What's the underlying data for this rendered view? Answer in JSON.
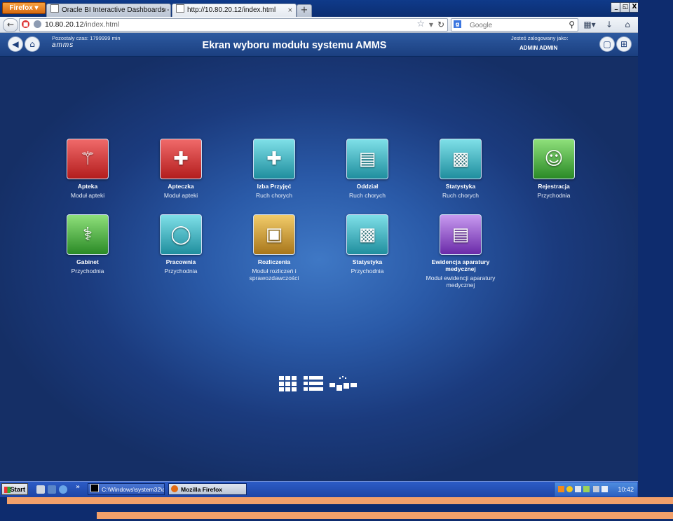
{
  "browser": {
    "menu_label": "Firefox ▾",
    "tabs": [
      {
        "label": "Oracle BI Interactive Dashboards - Ogóln...",
        "close": "×"
      },
      {
        "label": "http://10.80.20.12/index.html",
        "close": "×"
      }
    ],
    "new_tab": "+",
    "window_buttons": [
      "_",
      "◱",
      "X"
    ],
    "url_host": "10.80.20.12",
    "url_path": "/index.html",
    "search_placeholder": "Google"
  },
  "header": {
    "time_left": "Pozostały czas: 1799999 min",
    "logo": "amms",
    "title": "Ekran wyboru modułu systemu AMMS",
    "logged_in_label": "Jesteś zalogowany jako:",
    "user": "ADMIN ADMIN"
  },
  "modules": [
    {
      "title": "Apteka",
      "subtitle": "Moduł apteki",
      "icon": "pharmacy-icon"
    },
    {
      "title": "Apteczka",
      "subtitle": "Moduł apteki",
      "icon": "first-aid-kit-icon"
    },
    {
      "title": "Izba Przyjęć",
      "subtitle": "Ruch chorych",
      "icon": "reception-desk-icon"
    },
    {
      "title": "Oddział",
      "subtitle": "Ruch chorych",
      "icon": "hospital-bed-icon"
    },
    {
      "title": "Statystyka",
      "subtitle": "Ruch chorych",
      "icon": "bar-chart-icon"
    },
    {
      "title": "Rejestracja",
      "subtitle": "Przychodnia",
      "icon": "registration-icon"
    },
    {
      "title": "Gabinet",
      "subtitle": "Przychodnia",
      "icon": "doctor-icon"
    },
    {
      "title": "Pracownia",
      "subtitle": "Przychodnia",
      "icon": "lab-scanner-icon"
    },
    {
      "title": "Rozliczenia",
      "subtitle": "Moduł rozliczeń i sprawozdawczości",
      "icon": "money-icon"
    },
    {
      "title": "Statystyka",
      "subtitle": "Przychodnia",
      "icon": "bar-chart-icon"
    },
    {
      "title": "Ewidencja aparatury medycznej",
      "subtitle": "Moduł ewidencji aparatury medycznej",
      "icon": "medical-device-icon"
    }
  ],
  "taskbar": {
    "start": "Start",
    "chevron": "»",
    "cmd": "C:\\Windows\\system32\\c...",
    "firefox": "Mozilla Firefox",
    "clock": "10:42"
  }
}
